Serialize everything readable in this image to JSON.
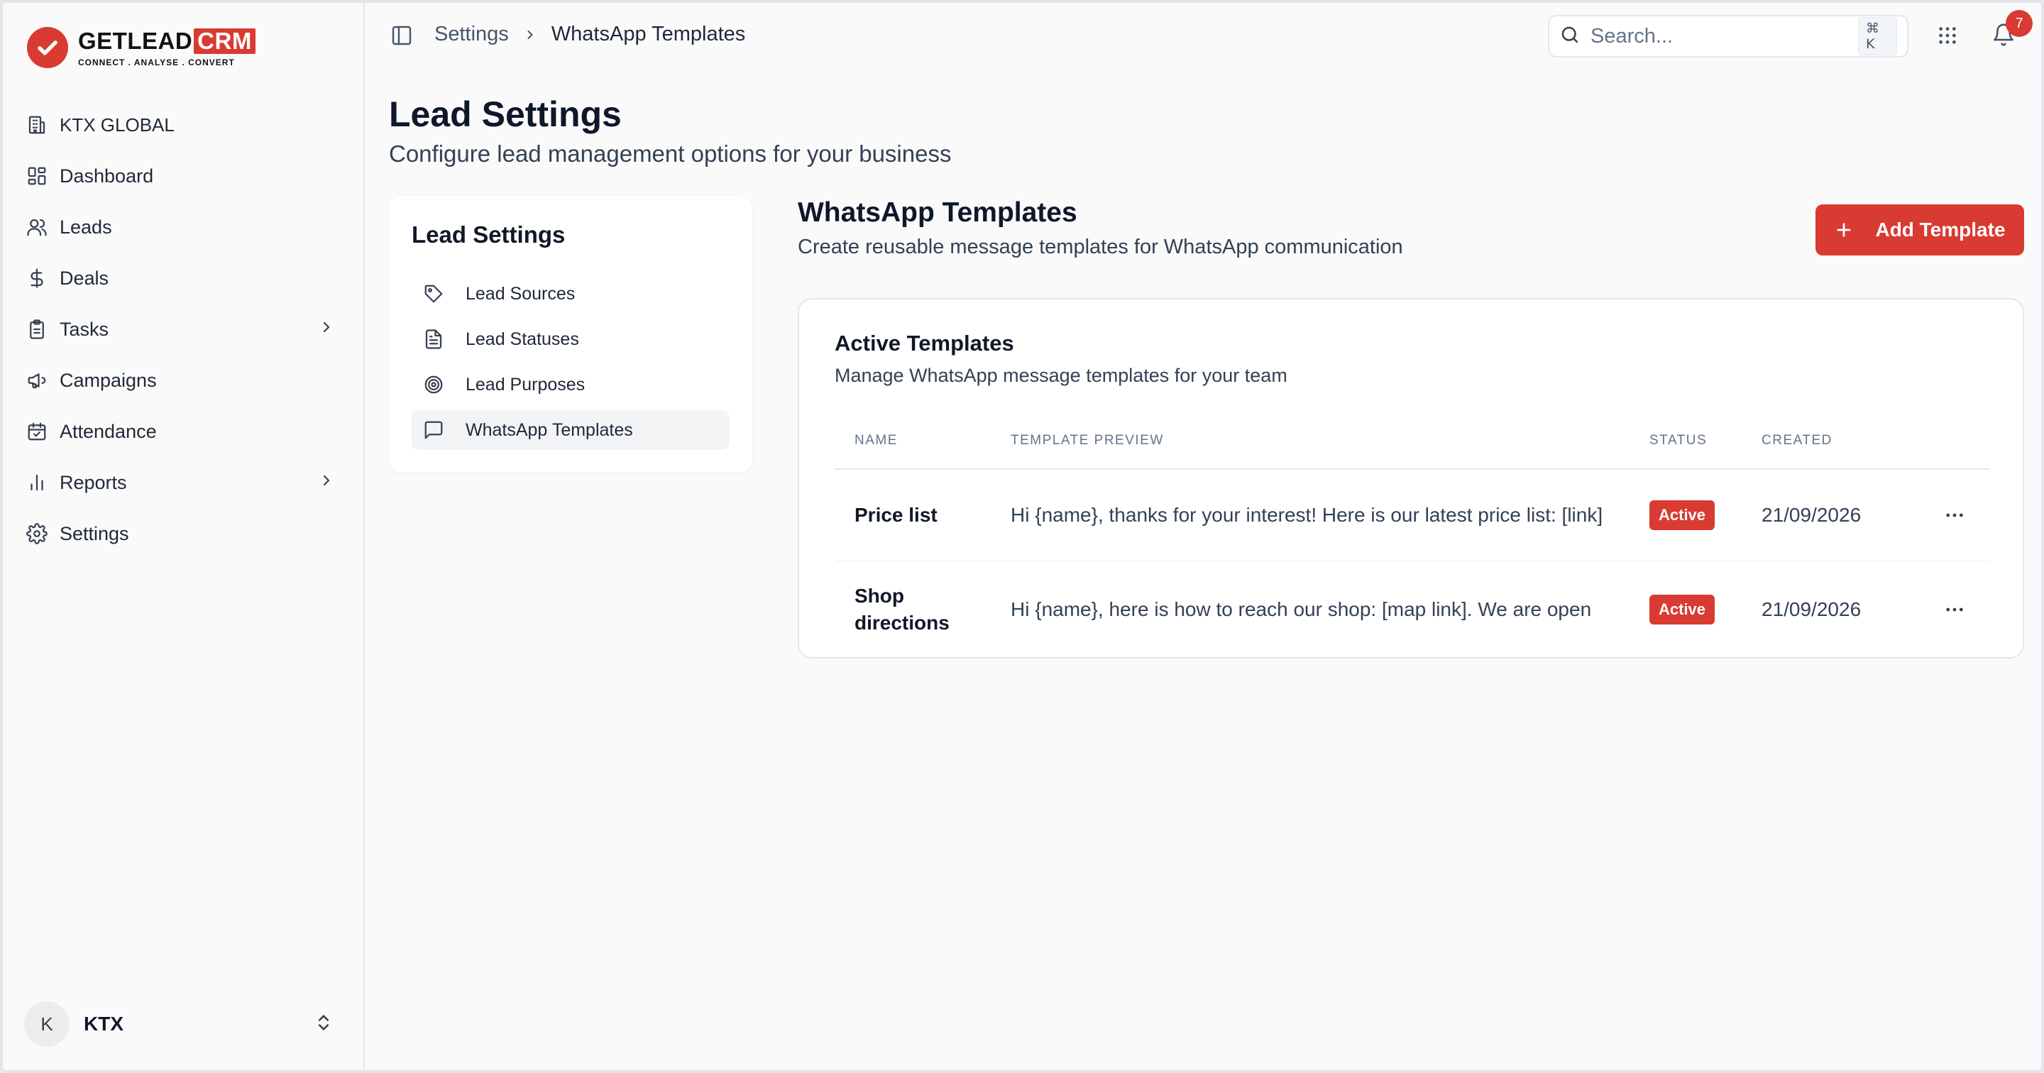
{
  "brand": {
    "name": "GETLEAD",
    "suffix": "CRM",
    "tagline": "CONNECT  .  ANALYSE  .  CONVERT"
  },
  "org": {
    "name": "KTX GLOBAL"
  },
  "nav": {
    "items": [
      {
        "label": "Dashboard",
        "icon": "grid-icon",
        "has_submenu": false
      },
      {
        "label": "Leads",
        "icon": "users-icon",
        "has_submenu": false
      },
      {
        "label": "Deals",
        "icon": "dollar-icon",
        "has_submenu": false
      },
      {
        "label": "Tasks",
        "icon": "clipboard-icon",
        "has_submenu": true
      },
      {
        "label": "Campaigns",
        "icon": "megaphone-icon",
        "has_submenu": false
      },
      {
        "label": "Attendance",
        "icon": "calendar-check-icon",
        "has_submenu": false
      },
      {
        "label": "Reports",
        "icon": "bar-chart-icon",
        "has_submenu": true
      },
      {
        "label": "Settings",
        "icon": "gear-icon",
        "has_submenu": false
      }
    ]
  },
  "user": {
    "initial": "K",
    "name": "KTX"
  },
  "topbar": {
    "breadcrumb": [
      "Settings",
      "WhatsApp Templates"
    ],
    "search_placeholder": "Search...",
    "search_shortcut": "⌘ K",
    "notification_count": "7"
  },
  "page": {
    "title": "Lead Settings",
    "subtitle": "Configure lead management options for your business"
  },
  "settings_menu": {
    "title": "Lead Settings",
    "items": [
      {
        "label": "Lead Sources",
        "icon": "tag-icon",
        "active": false
      },
      {
        "label": "Lead Statuses",
        "icon": "document-icon",
        "active": false
      },
      {
        "label": "Lead Purposes",
        "icon": "target-icon",
        "active": false
      },
      {
        "label": "WhatsApp Templates",
        "icon": "chat-icon",
        "active": true
      }
    ]
  },
  "section": {
    "title": "WhatsApp Templates",
    "subtitle": "Create reusable message templates for WhatsApp communication",
    "add_button": "Add Template"
  },
  "templates": {
    "title": "Active Templates",
    "subtitle": "Manage WhatsApp message templates for your team",
    "columns": [
      "NAME",
      "TEMPLATE PREVIEW",
      "STATUS",
      "CREATED"
    ],
    "rows": [
      {
        "name": "Price list",
        "preview": "Hi {name}, thanks for your interest! Here is our latest price list: [link]",
        "status": "Active",
        "created": "21/09/2026"
      },
      {
        "name": "Shop directions",
        "preview": "Hi {name}, here is how to reach our shop: [map link]. We are open",
        "status": "Active",
        "created": "21/09/2026"
      }
    ]
  },
  "colors": {
    "accent": "#d93a31",
    "page_bg": "#fafafa",
    "card_bg": "#ffffff",
    "text": "#0f172a"
  }
}
